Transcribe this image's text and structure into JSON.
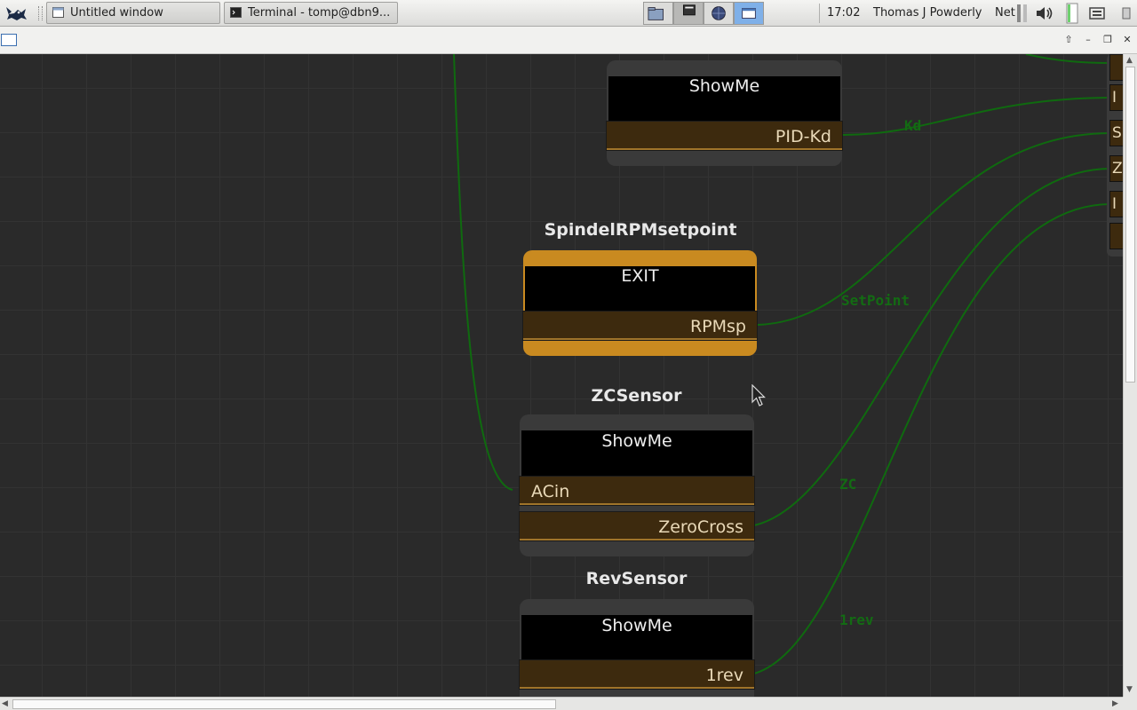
{
  "taskbar": {
    "tasks": [
      {
        "label": "Untitled window"
      },
      {
        "label": "Terminal - tomp@dbn9..."
      }
    ],
    "clock": "17:02",
    "user": "Thomas J Powderly",
    "net_label": "Net"
  },
  "nodes": {
    "pid": {
      "head": "ShowMe",
      "out_port": "PID-Kd"
    },
    "spindel": {
      "title": "SpindelRPMsetpoint",
      "head": "EXIT",
      "out_port": "RPMsp"
    },
    "zc": {
      "title": "ZCSensor",
      "head": "ShowMe",
      "in_port": "ACin",
      "out_port": "ZeroCross"
    },
    "rev": {
      "title": "RevSensor",
      "head": "ShowMe",
      "out_port": "1rev"
    }
  },
  "wire_labels": {
    "kd": "Kd",
    "setpoint": "SetPoint",
    "zc": "ZC",
    "rev": "1rev"
  },
  "right_node_ports": [
    "",
    "I",
    "S",
    "Z",
    "I",
    ""
  ],
  "colors": {
    "canvas": "#2a2a2a",
    "wire": "#0f6a0f",
    "active_node": "#c98a20",
    "port": "#3d2a0e"
  }
}
